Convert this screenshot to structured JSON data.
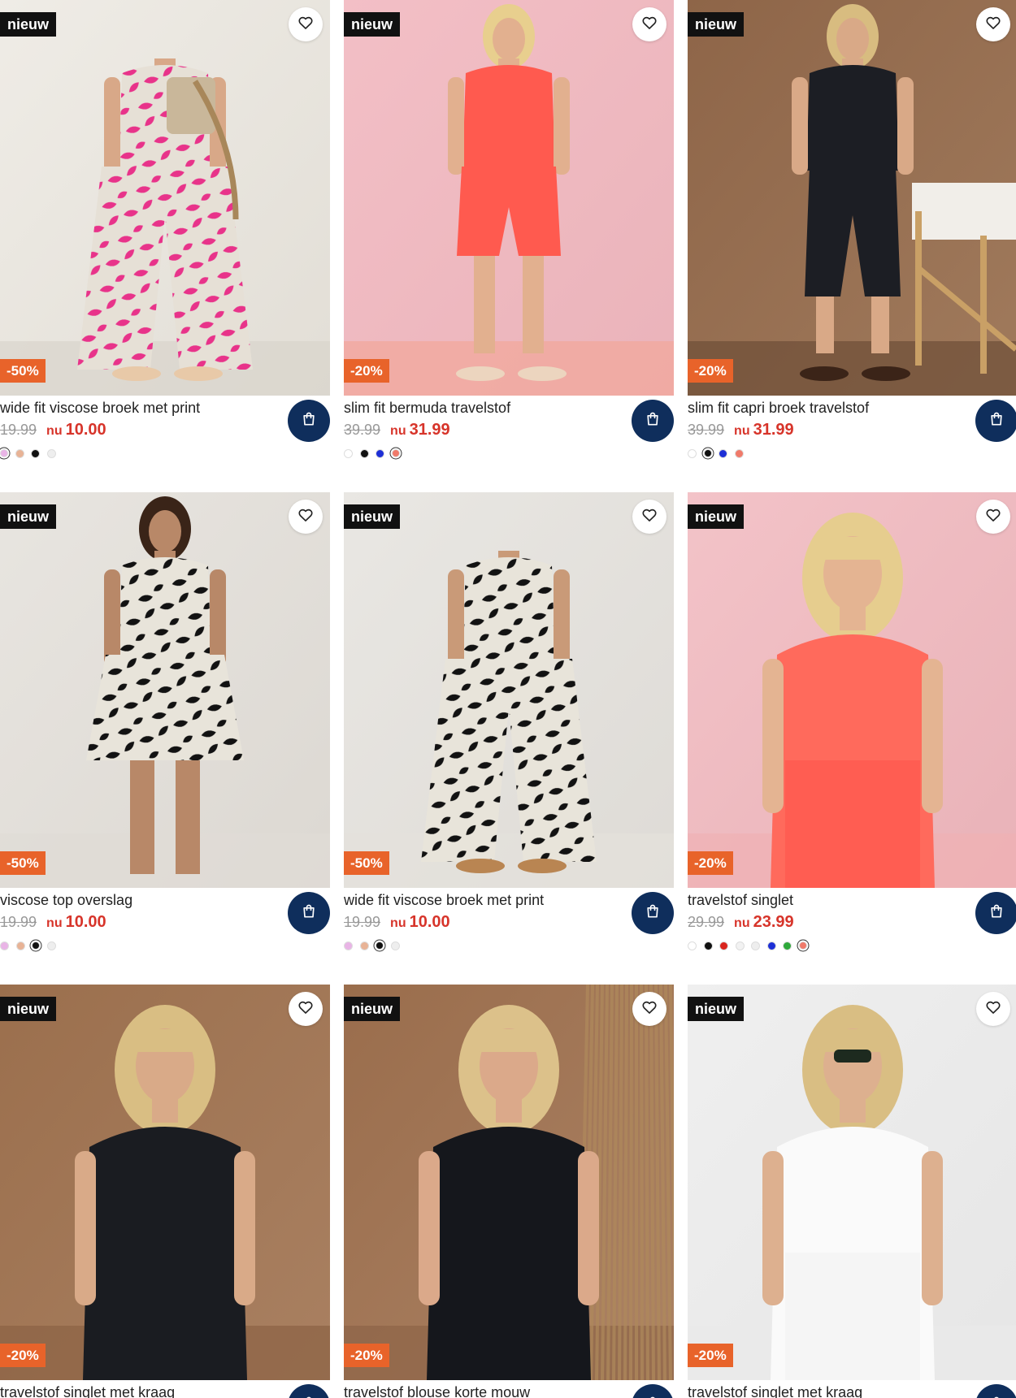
{
  "products": [
    {
      "badge_new": "nieuw",
      "discount": "-50%",
      "title": "wide fit viscose broek met print",
      "old_price": "19.99",
      "nu": "nu",
      "price": "10.00",
      "swatches": [
        "#e9b4e6",
        "#e8b396",
        "#111111",
        "#eeeeee"
      ],
      "selected": 0,
      "scene": "pinkleaf"
    },
    {
      "badge_new": "nieuw",
      "discount": "-20%",
      "title": "slim fit bermuda travelstof",
      "old_price": "39.99",
      "nu": "nu",
      "price": "31.99",
      "swatches": [
        "#ffffff",
        "#111111",
        "#1d2fd6",
        "#f07a6a"
      ],
      "selected": 3,
      "scene": "coralbermuda"
    },
    {
      "badge_new": "nieuw",
      "discount": "-20%",
      "title": "slim fit capri broek travelstof",
      "old_price": "39.99",
      "nu": "nu",
      "price": "31.99",
      "swatches": [
        "#ffffff",
        "#111111",
        "#1d2fd6",
        "#f07a6a"
      ],
      "selected": 1,
      "scene": "blackcapri"
    },
    {
      "badge_new": "nieuw",
      "discount": "-50%",
      "title": "viscose top overslag",
      "old_price": "19.99",
      "nu": "nu",
      "price": "10.00",
      "swatches": [
        "#e9b4e6",
        "#e8b396",
        "#111111",
        "#eeeeee"
      ],
      "selected": 2,
      "scene": "leaftop"
    },
    {
      "badge_new": "nieuw",
      "discount": "-50%",
      "title": "wide fit viscose broek met print",
      "old_price": "19.99",
      "nu": "nu",
      "price": "10.00",
      "swatches": [
        "#e9b4e6",
        "#e8b396",
        "#111111",
        "#eeeeee"
      ],
      "selected": 2,
      "scene": "leafpants"
    },
    {
      "badge_new": "nieuw",
      "discount": "-20%",
      "title": "travelstof singlet",
      "old_price": "29.99",
      "nu": "nu",
      "price": "23.99",
      "swatches": [
        "#ffffff",
        "#111111",
        "#d9251e",
        "#f2f2f2",
        "#eeeeee",
        "#1d2fd6",
        "#2ea83a",
        "#f07a6a"
      ],
      "selected": 7,
      "scene": "coralsinglet"
    },
    {
      "badge_new": "nieuw",
      "discount": "-20%",
      "title": "travelstof singlet met kraag",
      "old_price": "",
      "nu": "",
      "price": "",
      "swatches": [],
      "selected": -1,
      "scene": "blackkraag"
    },
    {
      "badge_new": "nieuw",
      "discount": "-20%",
      "title": "travelstof blouse korte mouw",
      "old_price": "",
      "nu": "",
      "price": "",
      "swatches": [],
      "selected": -1,
      "scene": "blackblouse"
    },
    {
      "badge_new": "nieuw",
      "discount": "-20%",
      "title": "travelstof singlet met kraag",
      "old_price": "",
      "nu": "",
      "price": "",
      "swatches": [],
      "selected": -1,
      "scene": "whitekraag"
    }
  ],
  "icons": {
    "favorite": "heart-icon",
    "cart": "shopping-bag-icon"
  },
  "colors": {
    "cart_button": "#0f2e5c",
    "discount_badge": "#e8632a",
    "new_badge": "#111111",
    "sale_price": "#d7342a"
  }
}
